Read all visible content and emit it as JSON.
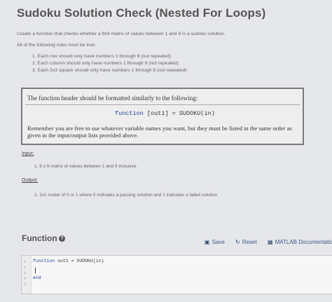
{
  "title": "Sudoku Solution Check (Nested For Loops)",
  "intro": "Create a function that checks whether a 9x9 matrix of values between 1 and 9 is a sudoku solution.",
  "rules_intro": "All of the following rules must be true:",
  "rules": [
    "1. Each row should only have numbers 1 through 9 (not repeated)",
    "2. Each column should only have numbers 1 through 9 (not repeated)",
    "3. Each 3x3 square should only have numbers 1 through 9 (not repeated)"
  ],
  "header_box": {
    "title": "The function header should be formatted similarly to the following:",
    "code_keyword": "function",
    "code_rest": " [out1] = SUDOKU(in)",
    "note": "Remember you are free to use whatever variable names you want, but they must be listed in the same order as given in the input/output lists provided above."
  },
  "input": {
    "label": "Input:",
    "items": [
      "1. 9 x 9 matrix of values between 1 and 9 inclusive."
    ]
  },
  "output": {
    "label": "Output:",
    "items": [
      "1. 1x1 scalar of 0 or 1 where 0 indicates a passing solution and 1 indicates a failed solution"
    ]
  },
  "function_section": {
    "heading": "Function",
    "help_icon": "question-circle-icon",
    "toolbar": {
      "save_label": "Save",
      "save_icon": "save-icon",
      "reset_label": "Reset",
      "reset_icon": "reset-icon",
      "docs_label": "MATLAB Documentation",
      "docs_icon": "book-icon"
    }
  },
  "editor": {
    "line_numbers": [
      "1",
      "2",
      "3",
      "4",
      "5"
    ],
    "lines": [
      {
        "keyword": "function",
        "rest": " out1 = SUDOKU(in)"
      },
      {
        "keyword": "",
        "rest": ""
      },
      {
        "keyword": "",
        "rest": ""
      },
      {
        "keyword": "end",
        "rest": ""
      },
      {
        "keyword": "",
        "rest": ""
      }
    ]
  },
  "colors": {
    "page_bg": "#e6e7ea",
    "keyword": "#1a3d99",
    "toolbar_text": "#3b5b88"
  }
}
